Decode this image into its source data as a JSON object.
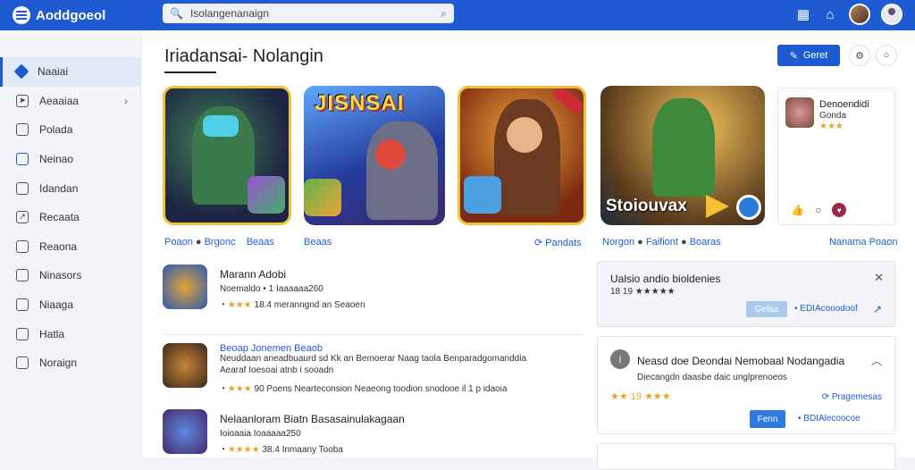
{
  "app": {
    "title": "Aoddgoeol"
  },
  "search": {
    "placeholder": "Isolangenanaign"
  },
  "sidebar": {
    "items": [
      {
        "label": "Naaiai",
        "active": true
      },
      {
        "label": "Aeaaiaa",
        "has_chevron": true
      },
      {
        "label": "Polada"
      },
      {
        "label": "Neinao"
      },
      {
        "label": "Idandan"
      },
      {
        "label": "Recaata"
      },
      {
        "label": "Reaona"
      },
      {
        "label": "Ninasors"
      },
      {
        "label": "Niaaga"
      },
      {
        "label": "Hatla"
      },
      {
        "label": "Noraign"
      }
    ]
  },
  "main": {
    "title": "Iriadansai- Nolangin",
    "primary_button": "Geret",
    "featured": {
      "card2_text": "JISNSAI",
      "card4_text": "Stoiouvax",
      "captions": [
        {
          "text": "Poaon",
          "extra": "Brgonc",
          "extra2": "Beaas"
        },
        {
          "text": "Beaas"
        },
        {
          "text": "Pandats"
        },
        {
          "text": "Norgon",
          "extra": "Faifiont",
          "extra2": "Boaras"
        },
        {
          "text": "Nanama Poaon"
        }
      ],
      "side_card": {
        "title": "Denoendidi",
        "subtitle": "Gonda",
        "stars": "★★★"
      }
    },
    "list": [
      {
        "title": "Marann Adobi",
        "sub": "Noemaldo • 1 Iaaaaaa260",
        "stars": "★★★",
        "meta": "18.4 meranngnd an Seaoen"
      },
      {
        "title": "Beoap Jonemen Beaob",
        "sub": "Neuddaan aneadbuaurd sd Kk an Bemoerar Naag taola Benparadgomanddia",
        "sub2": "Aearaf Ioesoai atnb i sooadn",
        "stars": "★★★",
        "meta": "90  Poens   Nearteconsion Neaeong toodion snodooe il 1 p idaoia"
      },
      {
        "title": "Nelaanloram Biatn Basasainulakagaan",
        "sub": "Ioioaaia Ioaaaaa250",
        "stars": "★★★★",
        "meta": "38.4 Inmaany Tooba"
      }
    ],
    "panel1": {
      "title": "Ualsio andio bioldenies",
      "sub": "18 19 ★★★★★",
      "btn": "Gelaa",
      "link": "• EDIAcooodoof"
    },
    "panel2": {
      "title": "Neasd doe Deondai Nemobaal Nodangadia",
      "sub": "Diecangdn daasbe daic unglprenoeos",
      "stars": "★★ 19 ★★★",
      "link": "Pragemesas",
      "btn": "Fenn",
      "link2": "• BDIAlecoocoe"
    }
  },
  "colors": {
    "brand": "#1e5bd3",
    "star": "#e0a823"
  }
}
